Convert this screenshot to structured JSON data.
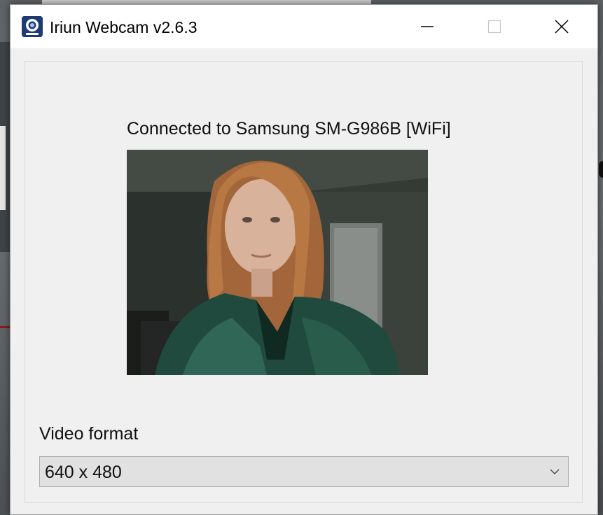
{
  "window": {
    "title": "Iriun Webcam v2.6.3",
    "icon": "webcam-app-icon",
    "controls": {
      "minimize_icon": "minimize-icon",
      "maximize_icon": "maximize-icon",
      "close_icon": "close-icon"
    }
  },
  "main": {
    "status": "Connected to Samsung SM-G986B [WiFi]",
    "preview": {
      "description_icon": "camera-preview-image"
    },
    "video_format": {
      "label": "Video format",
      "selected": "640 x 480",
      "arrow_icon": "chevron-down-icon"
    }
  },
  "colors": {
    "titlebar": "#ffffff",
    "window_bg": "#f0f0f0",
    "select_bg": "#e1e1e1",
    "icon_bg": "#1f3b73"
  }
}
